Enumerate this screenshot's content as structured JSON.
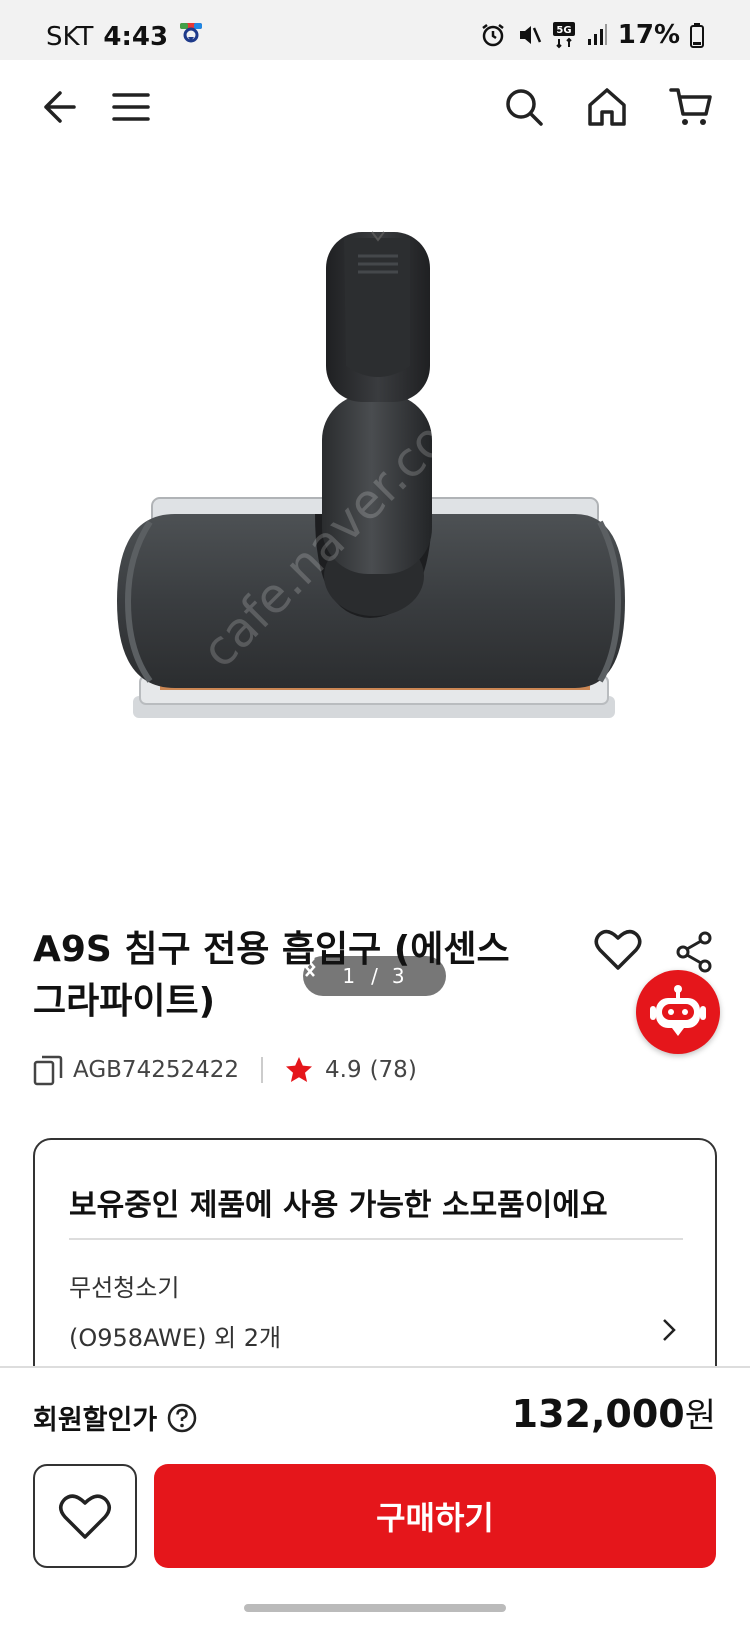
{
  "status_bar": {
    "carrier": "SKT",
    "time": "4:43",
    "network": "5G",
    "battery": "17%"
  },
  "nav": {
    "back_icon": "back-arrow-icon",
    "menu_icon": "hamburger-menu-icon",
    "search_icon": "search-icon",
    "home_icon": "home-icon",
    "cart_icon": "cart-icon"
  },
  "gallery": {
    "current": "1",
    "separator": "/",
    "total": "3"
  },
  "product": {
    "title_line1": "A9S 침구 전용 흡입구 (에센스",
    "title_line2": "그라파이트)",
    "model_code": "AGB74252422",
    "rating": "4.9",
    "review_count": "(78)"
  },
  "compat": {
    "title": "보유중인 제품에 사용 가능한 소모품이에요",
    "line1": "무선청소기",
    "line2": "(O958AWE) 외 2개"
  },
  "purchase": {
    "price_label": "회원할인가",
    "price": "132,000",
    "price_unit": "원",
    "buy_label": "구매하기"
  },
  "colors": {
    "accent": "#e5161b",
    "star": "#e5161b",
    "text": "#111111"
  }
}
